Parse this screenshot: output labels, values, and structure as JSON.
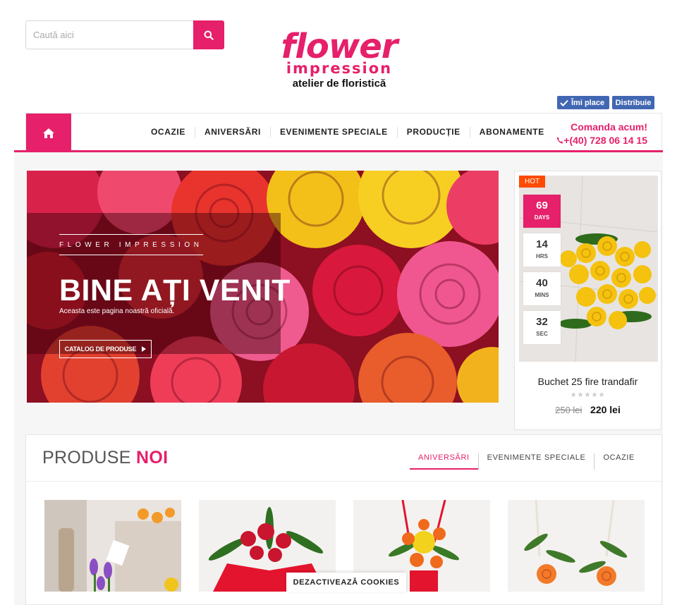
{
  "search": {
    "placeholder": "Caută aici"
  },
  "logo": {
    "word": "flower",
    "sub": "impression",
    "tagline": "atelier de floristică"
  },
  "social": {
    "like_label": "Îmi place",
    "share_label": "Distribuie"
  },
  "nav": {
    "items": [
      {
        "label": "OCAZIE"
      },
      {
        "label": "ANIVERSĂRI"
      },
      {
        "label": "EVENIMENTE SPECIALE"
      },
      {
        "label": "PRODUCȚIE"
      },
      {
        "label": "ABONAMENTE"
      }
    ],
    "order_label": "Comanda acum!",
    "phone": "+(40) 728 06 14 15"
  },
  "hero": {
    "brand": "FLOWER IMPRESSION",
    "title": "BINE AȚI VENIT",
    "subtitle": "Aceasta este pagina noastră oficială.",
    "cta": "CATALOG DE PRODUSE"
  },
  "deal": {
    "badge": "HOT",
    "countdown": [
      {
        "value": "69",
        "unit": "DAYS"
      },
      {
        "value": "14",
        "unit": "HRS"
      },
      {
        "value": "40",
        "unit": "MINS"
      },
      {
        "value": "32",
        "unit": "SEC"
      }
    ],
    "name": "Buchet 25 fire trandafir",
    "rating": 0,
    "old_price": "250 lei",
    "new_price": "220 lei"
  },
  "products": {
    "title_light": "PRODUSE",
    "title_bold": "NOI",
    "tabs": [
      {
        "label": "ANIVERSĂRI",
        "active": true
      },
      {
        "label": "EVENIMENTE SPECIALE",
        "active": false
      },
      {
        "label": "OCAZIE",
        "active": false
      }
    ]
  },
  "cookies": {
    "label": "DEZACTIVEAZĂ COOKIES"
  },
  "colors": {
    "accent": "#e6206a",
    "facebook": "#4267b2",
    "hot": "#ff4a00"
  }
}
